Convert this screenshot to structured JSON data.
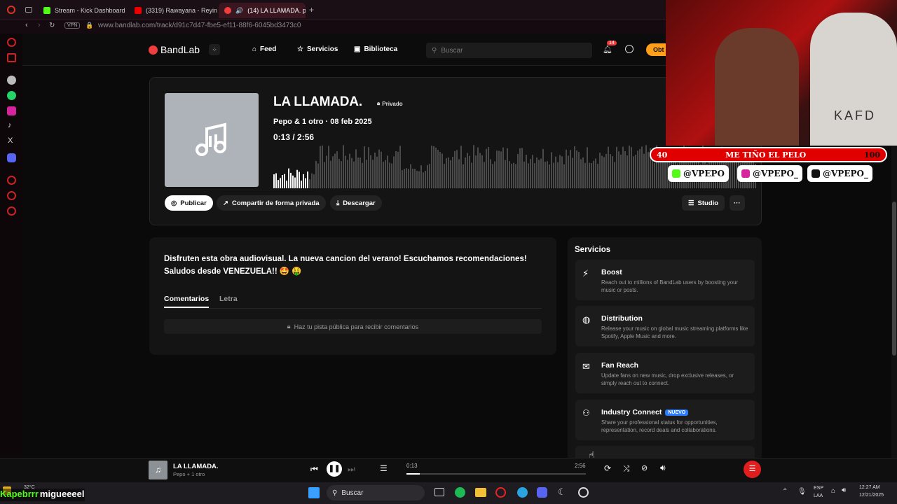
{
  "browser": {
    "tabs": [
      {
        "label": "Stream - Kick Dashboard",
        "active": false
      },
      {
        "label": "(3319) Rawayana - Reyin",
        "active": false
      },
      {
        "label": "(14) LA LLAMADA. po",
        "active": true
      }
    ],
    "vpn_label": "VPN",
    "url": "www.bandlab.com/track/d91c7d47-fbe5-ef11-88f6-6045bd3473c0"
  },
  "nav": {
    "logo": "BandLab",
    "links": [
      "Feed",
      "Servicios",
      "Biblioteca"
    ],
    "search_placeholder": "Buscar",
    "notif_count": "14",
    "cta": "Obt"
  },
  "track": {
    "title": "LA LLAMADA.",
    "privacy": "Privado",
    "byline": "Pepo & 1 otro · 08 feb 2025",
    "current_time": "0:13",
    "separator": " / ",
    "duration": "2:56",
    "progress": 0.074,
    "buttons": {
      "publish": "Publicar",
      "share": "Compartir de forma privada",
      "download": "Descargar",
      "studio": "Studio"
    }
  },
  "description": {
    "text": "Disfruten esta obra audiovisual. La nueva cancion del verano! Escuchamos recomendaciones! Saludos desde VENEZUELA!! 🤩 🤑",
    "tabs": [
      "Comentarios",
      "Letra"
    ],
    "lock_notice": "Haz tu pista pública para recibir comentarios"
  },
  "services": {
    "title": "Servicios",
    "items": [
      {
        "name": "Boost",
        "icon": "bolt-icon",
        "desc": "Reach out to millions of BandLab users by boosting your music or posts.",
        "badge": ""
      },
      {
        "name": "Distribution",
        "icon": "globe-note-icon",
        "desc": "Release your music on global music streaming platforms like Spotify, Apple Music and more.",
        "badge": ""
      },
      {
        "name": "Fan Reach",
        "icon": "mail-icon",
        "desc": "Update fans on new music, drop exclusive releases, or simply reach out to connect.",
        "badge": ""
      },
      {
        "name": "Industry Connect",
        "icon": "people-icon",
        "desc": "Share your professional status for opportunities, representation, record deals and collaborations.",
        "badge": "NUEVO"
      }
    ]
  },
  "player": {
    "title": "LA LLAMADA.",
    "subtitle": "Pepo + 1 otro",
    "elapsed": "0:13",
    "total": "2:56",
    "progress": 0.074
  },
  "taskbar": {
    "weather": "32°C",
    "search": "Buscar",
    "lang": "ESP",
    "region": "LAA",
    "time": "12:27 AM",
    "date": "12/21/2025"
  },
  "stream_overlay": {
    "goal_start": "40",
    "goal_label": "ME TIÑO EL PELO",
    "goal_end": "100",
    "handles": [
      "@VPEPO",
      "@VPEPO_",
      "@VPEPO_"
    ],
    "chat_user": "Kapebrrr",
    "chat_msg": "migueeeel",
    "cam_print": "KAFD"
  },
  "colors": {
    "brand": "#f03e3e",
    "accent_blue": "#2a7bff",
    "cta_orange": "#ff9f1a",
    "goal_red": "#e00000"
  }
}
